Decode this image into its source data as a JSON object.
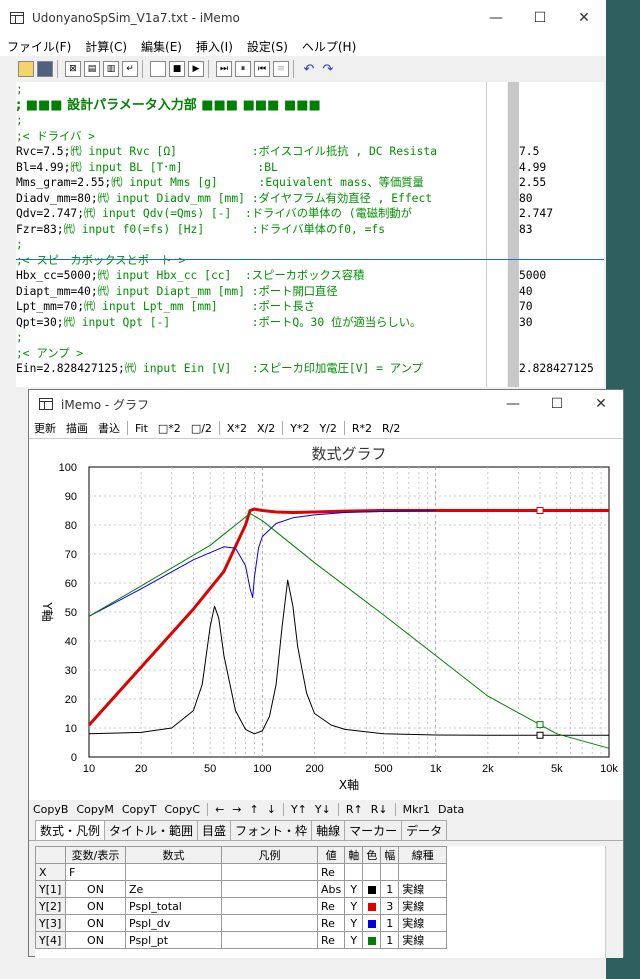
{
  "main": {
    "title": "UdonyanoSpSim_V1a7.txt - iMemo",
    "win_min": "—",
    "win_max": "☐",
    "win_close": "✕",
    "menu": [
      "ファイル(F)",
      "計算(C)",
      "編集(E)",
      "挿入(I)",
      "設定(S)",
      "ヘルプ(H)"
    ],
    "editor_lines": [
      {
        "text": ";",
        "style": "c"
      },
      {
        "text": "; ■■■ 設計パラメータ入力部 ■■■ ■■■ ■■■",
        "style": "h"
      },
      {
        "text": ";",
        "style": "c"
      },
      {
        "text": ";< ドライバ >",
        "style": "c"
      },
      {
        "code": "Rvc=7.5;",
        "comment": "㈹ input Rvc [Ω]           :ボイスコイル抵抗 , DC Resista"
      },
      {
        "code": "Bl=4.99;",
        "comment": "㈹ input BL [T･m]           :BL"
      },
      {
        "code": "Mms_gram=2.55;",
        "comment": "㈹ input Mms [g]      :Equivalent mass、等価質量"
      },
      {
        "code": "Diadv_mm=80;",
        "comment": "㈹ input Diadv_mm [mm] :ダイヤフラム有効直径 , Effect"
      },
      {
        "code": "Qdv=2.747;",
        "comment": "㈹ input Qdv(=Qms) [-]  :ドライバの単体の (電磁制動が"
      },
      {
        "code": "Fzr=83;",
        "comment": "㈹ input f0(=fs) [Hz]       :ドライバ単体のf0, =fs"
      },
      {
        "text": ";",
        "style": "c"
      },
      {
        "text": ";< スピーカボックスとポート >",
        "style": "c"
      },
      {
        "code": "Hbx_cc=5000;",
        "comment": "㈹ input Hbx_cc [cc]  :スピーカボックス容積"
      },
      {
        "code": "Diapt_mm=40;",
        "comment": "㈹ input Diapt_mm [mm] :ポート開口直径"
      },
      {
        "code": "Lpt_mm=70;",
        "comment": "㈹ input Lpt_mm [mm]     :ポート長さ"
      },
      {
        "code": "Qpt=30;",
        "comment": "㈹ input Qpt [-]            :ポートQ。30 位が適当らしい。"
      },
      {
        "text": ";",
        "style": "c"
      },
      {
        "text": ";< アンプ >",
        "style": "c"
      },
      {
        "code": "Ein=2.828427125;",
        "comment": "㈹ input Ein [V]   :スピーカ印加電圧[V] = アンプ"
      }
    ],
    "values": [
      "",
      "",
      "",
      "",
      "7.5",
      "4.99",
      "2.55",
      "80",
      "2.747",
      "83",
      "",
      "",
      "5000",
      "40",
      "70",
      "30",
      "",
      "",
      "2.828427125"
    ]
  },
  "graph": {
    "title": "iMemo - グラフ",
    "menu": [
      "更新",
      "描画",
      "書込",
      "Fit",
      "□*2",
      "□/2",
      "X*2",
      "X/2",
      "Y*2",
      "Y/2",
      "R*2",
      "R/2"
    ],
    "buttons": [
      "CopyB",
      "CopyM",
      "CopyT",
      "CopyC",
      "←",
      "→",
      "↑",
      "↓",
      "Y↑",
      "Y↓",
      "R↑",
      "R↓",
      "Mkr1",
      "Data"
    ],
    "tabs": [
      "数式・凡例",
      "タイトル・範囲",
      "目盛",
      "フォント・枠",
      "軸線",
      "マーカー",
      "データ"
    ],
    "grid_headers": [
      "",
      "変数/表示",
      "数式",
      "凡例",
      "値",
      "軸",
      "色",
      "幅",
      "線種"
    ],
    "grid_rows": [
      {
        "label": "X",
        "show": "F",
        "expr": "",
        "legend": "",
        "val": "Re",
        "axis": "",
        "color": "",
        "width": "",
        "ltype": ""
      },
      {
        "label": "Y[1]",
        "show": "ON",
        "expr": "Ze",
        "legend": "",
        "val": "Abs",
        "axis": "Y",
        "color": "#000000",
        "width": "1",
        "ltype": "実線"
      },
      {
        "label": "Y[2]",
        "show": "ON",
        "expr": "Pspl_total",
        "legend": "",
        "val": "Re",
        "axis": "Y",
        "color": "#e00000",
        "width": "3",
        "ltype": "実線"
      },
      {
        "label": "Y[3]",
        "show": "ON",
        "expr": "Pspl_dv",
        "legend": "",
        "val": "Re",
        "axis": "Y",
        "color": "#0000e0",
        "width": "1",
        "ltype": "実線"
      },
      {
        "label": "Y[4]",
        "show": "ON",
        "expr": "Pspl_pt",
        "legend": "",
        "val": "Re",
        "axis": "Y",
        "color": "#008000",
        "width": "1",
        "ltype": "実線"
      }
    ]
  },
  "chart_data": {
    "type": "line",
    "title": "数式グラフ",
    "xlabel": "X軸",
    "ylabel": "Y軸",
    "xscale": "log",
    "xlim": [
      10,
      10000
    ],
    "ylim": [
      0,
      100
    ],
    "xticks": [
      "10",
      "20",
      "50",
      "100",
      "200",
      "500",
      "1k",
      "2k",
      "5k",
      "10k"
    ],
    "xtick_values": [
      10,
      20,
      50,
      100,
      200,
      500,
      1000,
      2000,
      5000,
      10000
    ],
    "yticks": [
      0,
      10,
      20,
      30,
      40,
      50,
      60,
      70,
      80,
      90,
      100
    ],
    "grid": true,
    "series": [
      {
        "color": "#000000",
        "width": 1,
        "marker_at": 4000,
        "x": [
          10,
          20,
          30,
          40,
          45,
          50,
          53,
          56,
          60,
          70,
          80,
          90,
          100,
          110,
          120,
          130,
          140,
          150,
          160,
          180,
          200,
          250,
          300,
          500,
          1000,
          2000,
          5000,
          10000
        ],
        "y": [
          8,
          8.5,
          10,
          16,
          25,
          45,
          52,
          48,
          35,
          16,
          9.5,
          8,
          9,
          14,
          25,
          45,
          61,
          52,
          38,
          22,
          15,
          11,
          9.5,
          8,
          7.6,
          7.5,
          7.5,
          7.5
        ]
      },
      {
        "color": "#e00000",
        "width": 3,
        "marker_at": 4000,
        "x": [
          10,
          20,
          40,
          60,
          80,
          85,
          90,
          100,
          120,
          150,
          200,
          300,
          500,
          1000,
          2000,
          5000,
          10000
        ],
        "y": [
          11,
          31,
          51,
          64,
          80,
          85,
          85.5,
          85,
          84.5,
          84.3,
          84.5,
          84.8,
          85,
          85,
          85,
          85,
          85
        ]
      },
      {
        "color": "#0000e0",
        "width": 1,
        "x": [
          10,
          20,
          40,
          60,
          70,
          80,
          85,
          88,
          90,
          95,
          100,
          120,
          150,
          200,
          300,
          500,
          1000
        ],
        "y": [
          48.5,
          58,
          68,
          72.5,
          72,
          66,
          58,
          55,
          62,
          72,
          76,
          80.5,
          82.5,
          83.5,
          84.3,
          84.7,
          85
        ]
      },
      {
        "color": "#008000",
        "width": 1,
        "marker_at": 4000,
        "x": [
          10,
          20,
          50,
          85,
          100,
          200,
          500,
          1000,
          2000,
          5000,
          10000
        ],
        "y": [
          48.5,
          59,
          73,
          84,
          81.5,
          67,
          49,
          35,
          21,
          8,
          3
        ]
      }
    ]
  }
}
